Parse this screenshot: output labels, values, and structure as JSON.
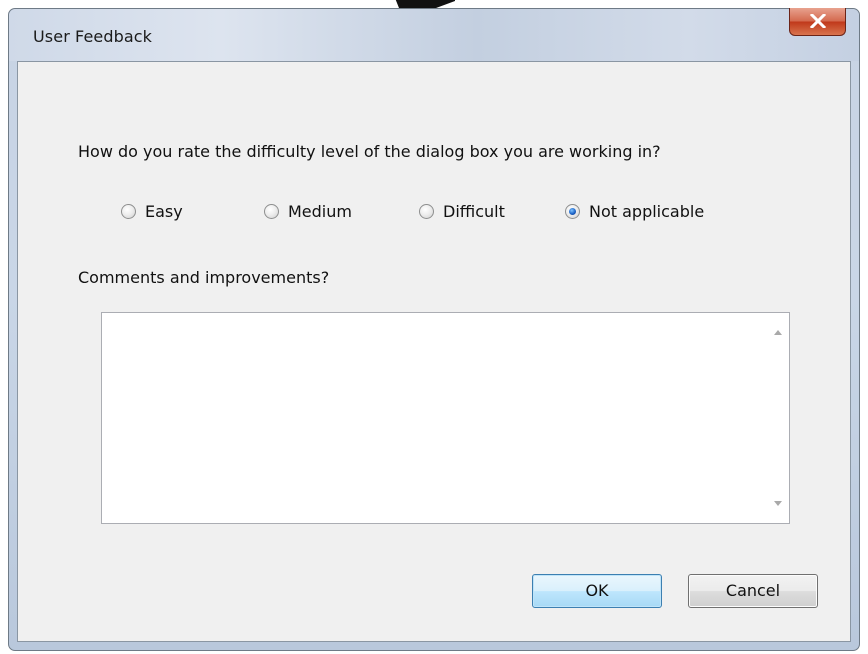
{
  "window": {
    "title": "User Feedback"
  },
  "question": {
    "text": "How do you rate the difficulty level of the dialog box you are working in?"
  },
  "rating_options": [
    {
      "label": "Easy",
      "checked": false
    },
    {
      "label": "Medium",
      "checked": false
    },
    {
      "label": "Difficult",
      "checked": false
    },
    {
      "label": "Not applicable",
      "checked": true
    }
  ],
  "comments": {
    "label": "Comments and improvements?",
    "value": ""
  },
  "buttons": {
    "ok": "OK",
    "cancel": "Cancel"
  },
  "colors": {
    "close_button": "#c0391b",
    "radio_selected": "#1d64c8",
    "ok_border": "#3c7fb1"
  }
}
